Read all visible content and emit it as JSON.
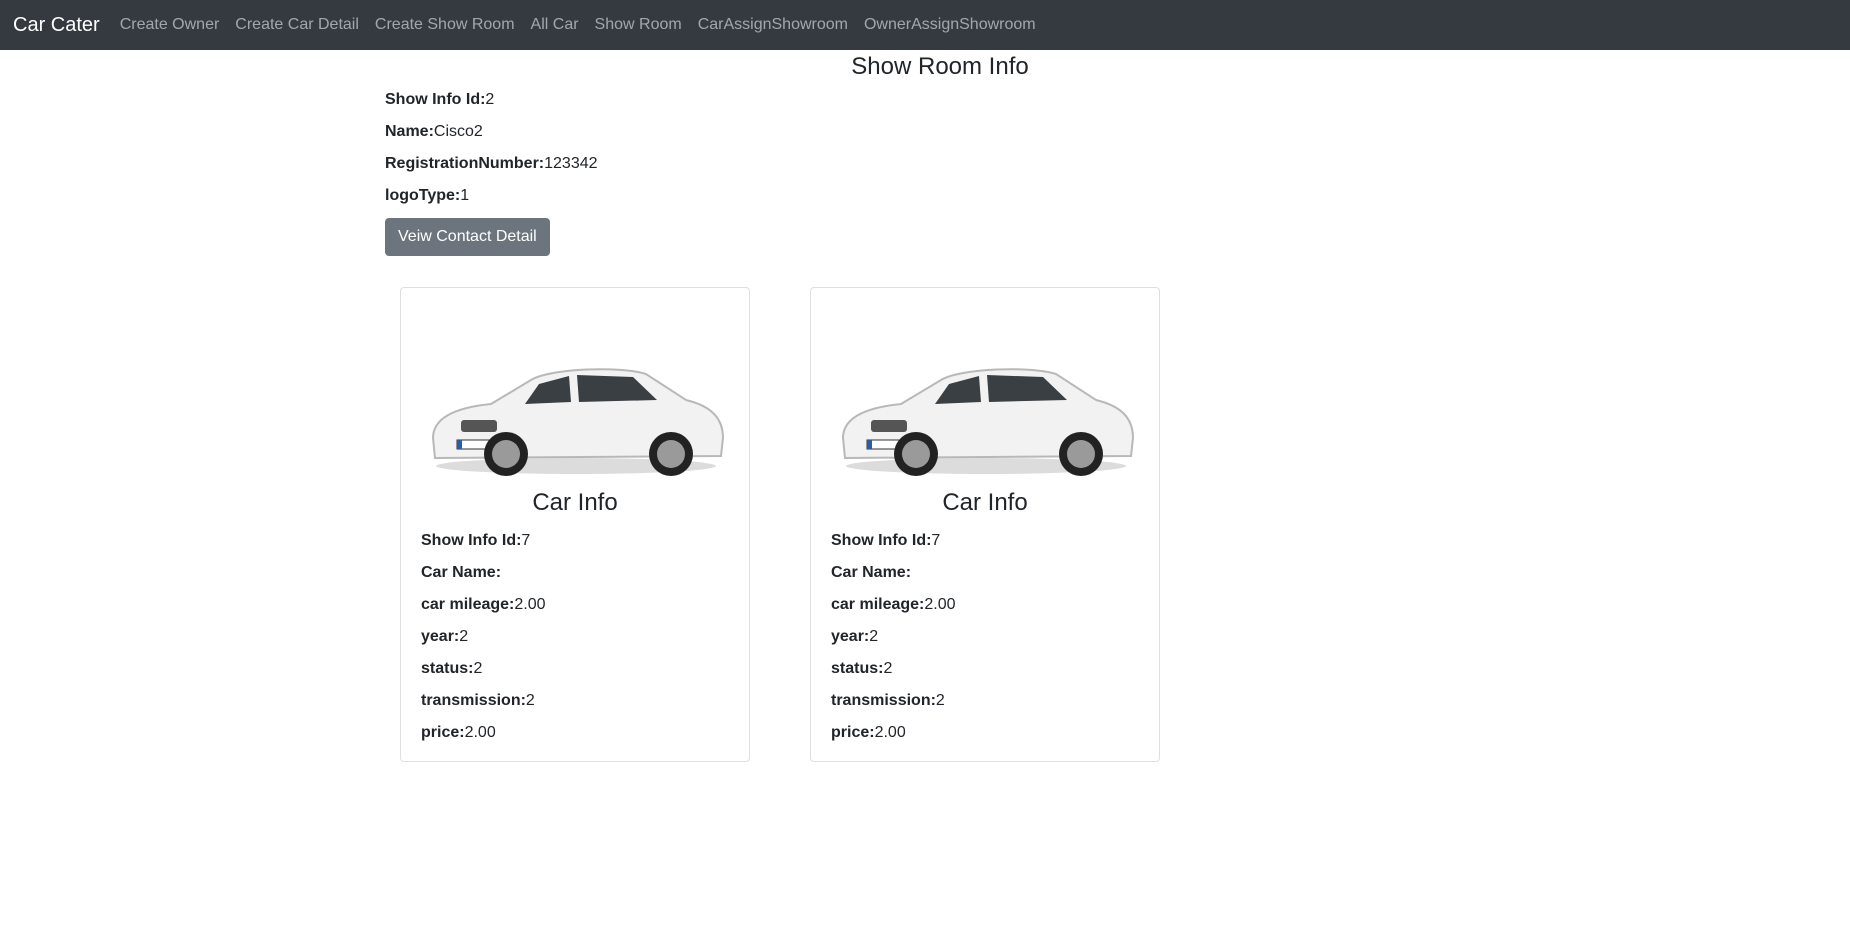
{
  "navbar": {
    "brand": "Car Cater",
    "links": [
      "Create Owner",
      "Create Car Detail",
      "Create Show Room",
      "All Car",
      "Show Room",
      "CarAssignShowroom",
      "OwnerAssignShowroom"
    ]
  },
  "showroom": {
    "title": "Show Room Info",
    "fields": [
      {
        "label": "Show Info Id:",
        "value": "2"
      },
      {
        "label": "Name:",
        "value": "Cisco2"
      },
      {
        "label": "RegistrationNumber:",
        "value": "123342"
      },
      {
        "label": "logoType:",
        "value": "1"
      }
    ],
    "button_label": "Veiw Contact Detail"
  },
  "cars": [
    {
      "title": "Car Info",
      "fields": [
        {
          "label": "Show Info Id:",
          "value": "7"
        },
        {
          "label": "Car Name:",
          "value": ""
        },
        {
          "label": "car mileage:",
          "value": "2.00"
        },
        {
          "label": "year:",
          "value": "2"
        },
        {
          "label": "status:",
          "value": "2"
        },
        {
          "label": "transmission:",
          "value": "2"
        },
        {
          "label": "price:",
          "value": "2.00"
        }
      ]
    },
    {
      "title": "Car Info",
      "fields": [
        {
          "label": "Show Info Id:",
          "value": "7"
        },
        {
          "label": "Car Name:",
          "value": ""
        },
        {
          "label": "car mileage:",
          "value": "2.00"
        },
        {
          "label": "year:",
          "value": "2"
        },
        {
          "label": "status:",
          "value": "2"
        },
        {
          "label": "transmission:",
          "value": "2"
        },
        {
          "label": "price:",
          "value": "2.00"
        }
      ]
    }
  ]
}
